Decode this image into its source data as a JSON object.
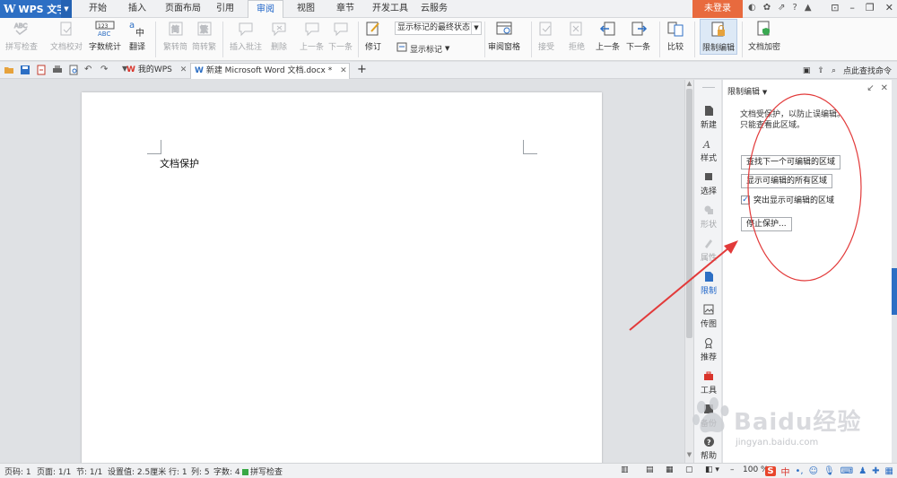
{
  "app": {
    "name": "WPS 文字",
    "logo": "W"
  },
  "menu": {
    "tabs": [
      "开始",
      "插入",
      "页面布局",
      "引用",
      "审阅",
      "视图",
      "章节",
      "开发工具",
      "云服务"
    ],
    "active_tab": "审阅",
    "login": "未登录"
  },
  "ribbon": {
    "spell_check": "拼写检查",
    "doc_proofread": "文档校对",
    "word_count": "字数统计",
    "translate": "翻译",
    "to_traditional": "繁转简",
    "to_simplified": "简转繁",
    "insert_comment": "插入批注",
    "delete": "删除",
    "prev": "上一条",
    "next": "下一条",
    "revise": "修订",
    "markup_combo": "显示标记的最终状态",
    "show_markup": "显示标记",
    "review_pane": "审阅窗格",
    "accept": "接受",
    "reject": "拒绝",
    "prev_change": "上一条",
    "next_change": "下一条",
    "compare": "比较",
    "restrict_edit": "限制编辑",
    "doc_encrypt": "文档加密"
  },
  "tabstrip": {
    "tabs": [
      {
        "label": "我的WPS"
      },
      {
        "label": "新建 Microsoft Word 文档.docx *"
      }
    ],
    "search": "点此查找命令"
  },
  "document": {
    "text": "文档保护"
  },
  "sidebar": {
    "items": [
      "新建",
      "样式",
      "选择",
      "形状",
      "属性",
      "限制",
      "传图",
      "推荐",
      "工具",
      "备份",
      "帮助"
    ]
  },
  "panel": {
    "title": "限制编辑",
    "desc_line1": "文档受保护，以防止误编辑。",
    "desc_line2": "只能查看此区域。",
    "find_next": "查找下一个可编辑的区域",
    "show_all": "显示可编辑的所有区域",
    "highlight": "突出显示可编辑的区域",
    "highlight_checked": true,
    "stop_protect": "停止保护..."
  },
  "watermark": {
    "text": "Baidu经验",
    "url": "jingyan.baidu.com"
  },
  "status": {
    "page_no": "页码: 1",
    "pages": "页面: 1/1",
    "section": "节: 1/1",
    "setting": "设置值: 2.5厘米",
    "row": "行: 1",
    "col": "列: 5",
    "chars": "字数: 4",
    "spell": "拼写检查",
    "zoom": "100 %"
  },
  "colors": {
    "accent": "#2d6fc4",
    "login": "#e86a3e",
    "annotation": "#e23a3a"
  }
}
